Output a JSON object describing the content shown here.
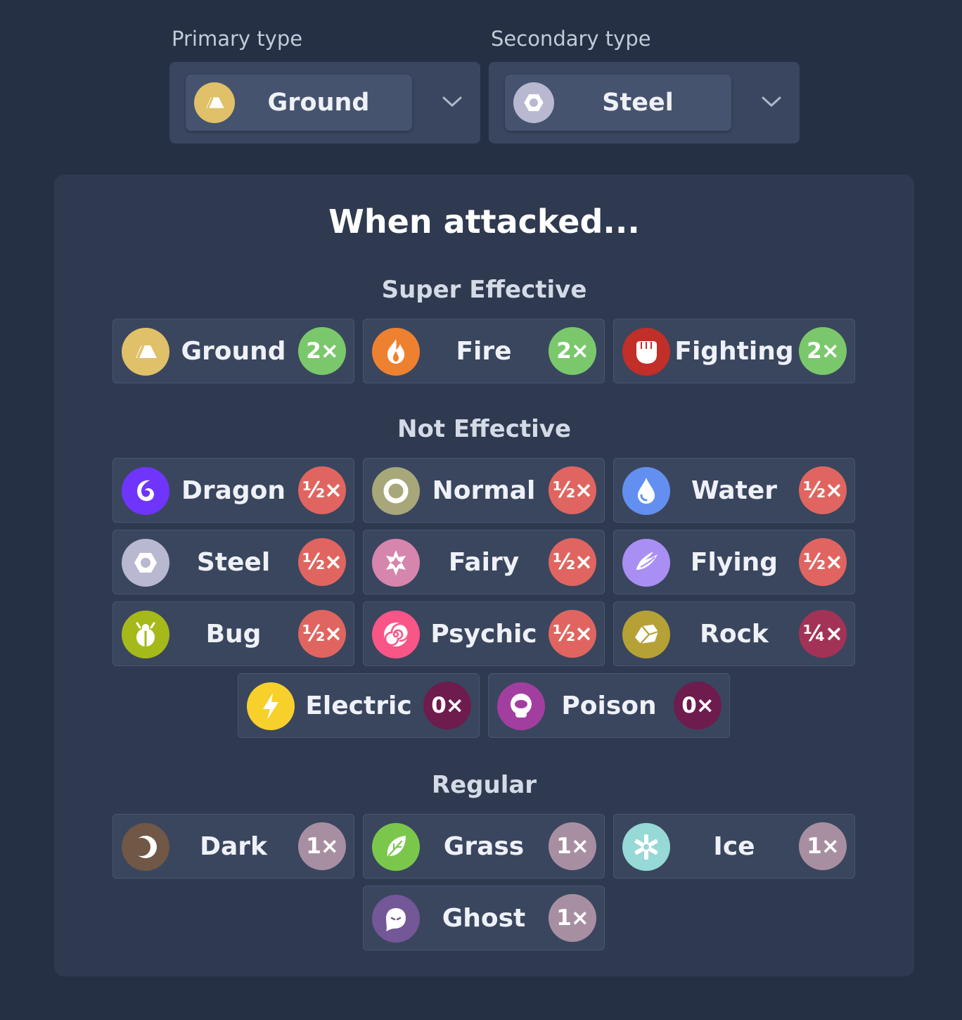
{
  "selects": {
    "primary": {
      "label": "Primary type",
      "value": "Ground",
      "icon": "ground-icon",
      "color": "#e0c068"
    },
    "secondary": {
      "label": "Secondary type",
      "value": "Steel",
      "icon": "steel-icon",
      "color": "#b8b8d0"
    }
  },
  "panel": {
    "title": "When attacked...",
    "sections": {
      "super": {
        "title": "Super Effective",
        "items": [
          {
            "name": "Ground",
            "mult": "2×",
            "icon": "ground-icon",
            "color": "#e0c068"
          },
          {
            "name": "Fire",
            "mult": "2×",
            "icon": "fire-icon",
            "color": "#ee8130"
          },
          {
            "name": "Fighting",
            "mult": "2×",
            "icon": "fighting-icon",
            "color": "#c22e28"
          }
        ]
      },
      "not": {
        "title": "Not Effective",
        "items": [
          {
            "name": "Dragon",
            "mult": "½×",
            "icon": "dragon-icon",
            "color": "#6f35fc"
          },
          {
            "name": "Normal",
            "mult": "½×",
            "icon": "normal-icon",
            "color": "#a8a77a"
          },
          {
            "name": "Water",
            "mult": "½×",
            "icon": "water-icon",
            "color": "#6390f0"
          },
          {
            "name": "Steel",
            "mult": "½×",
            "icon": "steel-icon",
            "color": "#b8b8d0"
          },
          {
            "name": "Fairy",
            "mult": "½×",
            "icon": "fairy-icon",
            "color": "#d685ad"
          },
          {
            "name": "Flying",
            "mult": "½×",
            "icon": "flying-icon",
            "color": "#a98ff3"
          },
          {
            "name": "Bug",
            "mult": "½×",
            "icon": "bug-icon",
            "color": "#a6b91a"
          },
          {
            "name": "Psychic",
            "mult": "½×",
            "icon": "psychic-icon",
            "color": "#f95587"
          },
          {
            "name": "Rock",
            "mult": "¼×",
            "icon": "rock-icon",
            "color": "#b6a136"
          },
          {
            "name": "Electric",
            "mult": "0×",
            "icon": "electric-icon",
            "color": "#f7d02c"
          },
          {
            "name": "Poison",
            "mult": "0×",
            "icon": "poison-icon",
            "color": "#a33ea1"
          }
        ]
      },
      "regular": {
        "title": "Regular",
        "items": [
          {
            "name": "Dark",
            "mult": "1×",
            "icon": "dark-icon",
            "color": "#705746"
          },
          {
            "name": "Grass",
            "mult": "1×",
            "icon": "grass-icon",
            "color": "#7ac74c"
          },
          {
            "name": "Ice",
            "mult": "1×",
            "icon": "ice-icon",
            "color": "#96d9d6"
          },
          {
            "name": "Ghost",
            "mult": "1×",
            "icon": "ghost-icon",
            "color": "#735797"
          }
        ]
      }
    }
  },
  "mult_colors": {
    "2×": "#7bc86c",
    "½×": "#e06560",
    "¼×": "#a33356",
    "0×": "#6e1b4e",
    "1×": "#a78fa1"
  }
}
